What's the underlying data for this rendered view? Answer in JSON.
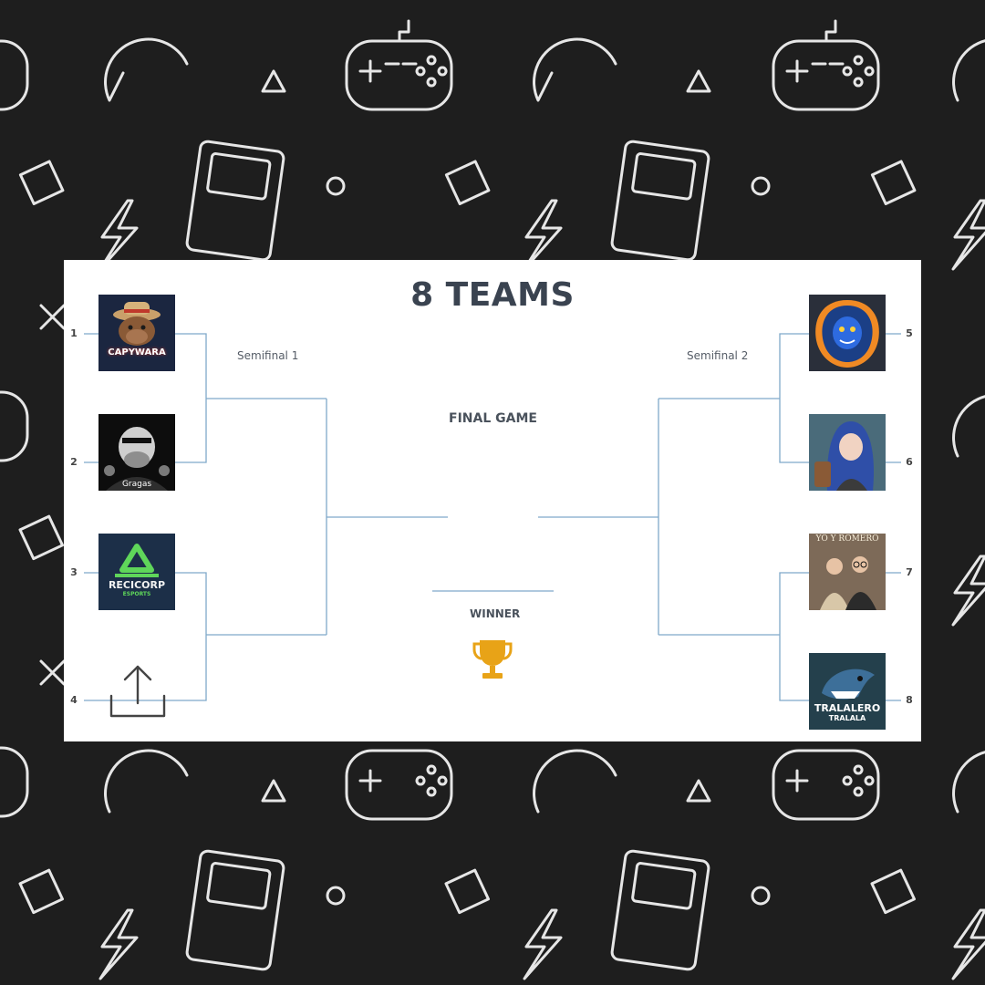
{
  "bracket": {
    "title": "8 TEAMS",
    "semifinal_left": "Semifinal 1",
    "semifinal_right": "Semifinal 2",
    "final_label": "FINAL GAME",
    "winner_label": "WINNER"
  },
  "teams": [
    {
      "seed": "1",
      "logo_text": "CAPYWARA"
    },
    {
      "seed": "2",
      "logo_text": "Gragas"
    },
    {
      "seed": "3",
      "logo_text": "RECICORP"
    },
    {
      "seed": "4",
      "logo_text": ""
    },
    {
      "seed": "5",
      "logo_text": ""
    },
    {
      "seed": "6",
      "logo_text": ""
    },
    {
      "seed": "7",
      "logo_text": "YO Y ROMERO"
    },
    {
      "seed": "8",
      "logo_text": "TRALALERO"
    }
  ],
  "team_subtext": {
    "recicorp": "ESPORTS",
    "tralalero": "TRALALA"
  },
  "icons": {
    "upload": "upload-icon",
    "trophy": "trophy-icon",
    "background": "gaming-pattern"
  },
  "colors": {
    "background": "#1e1e1e",
    "line": "#7fa9c9",
    "trophy": "#e8a317",
    "card": "#ffffff"
  }
}
